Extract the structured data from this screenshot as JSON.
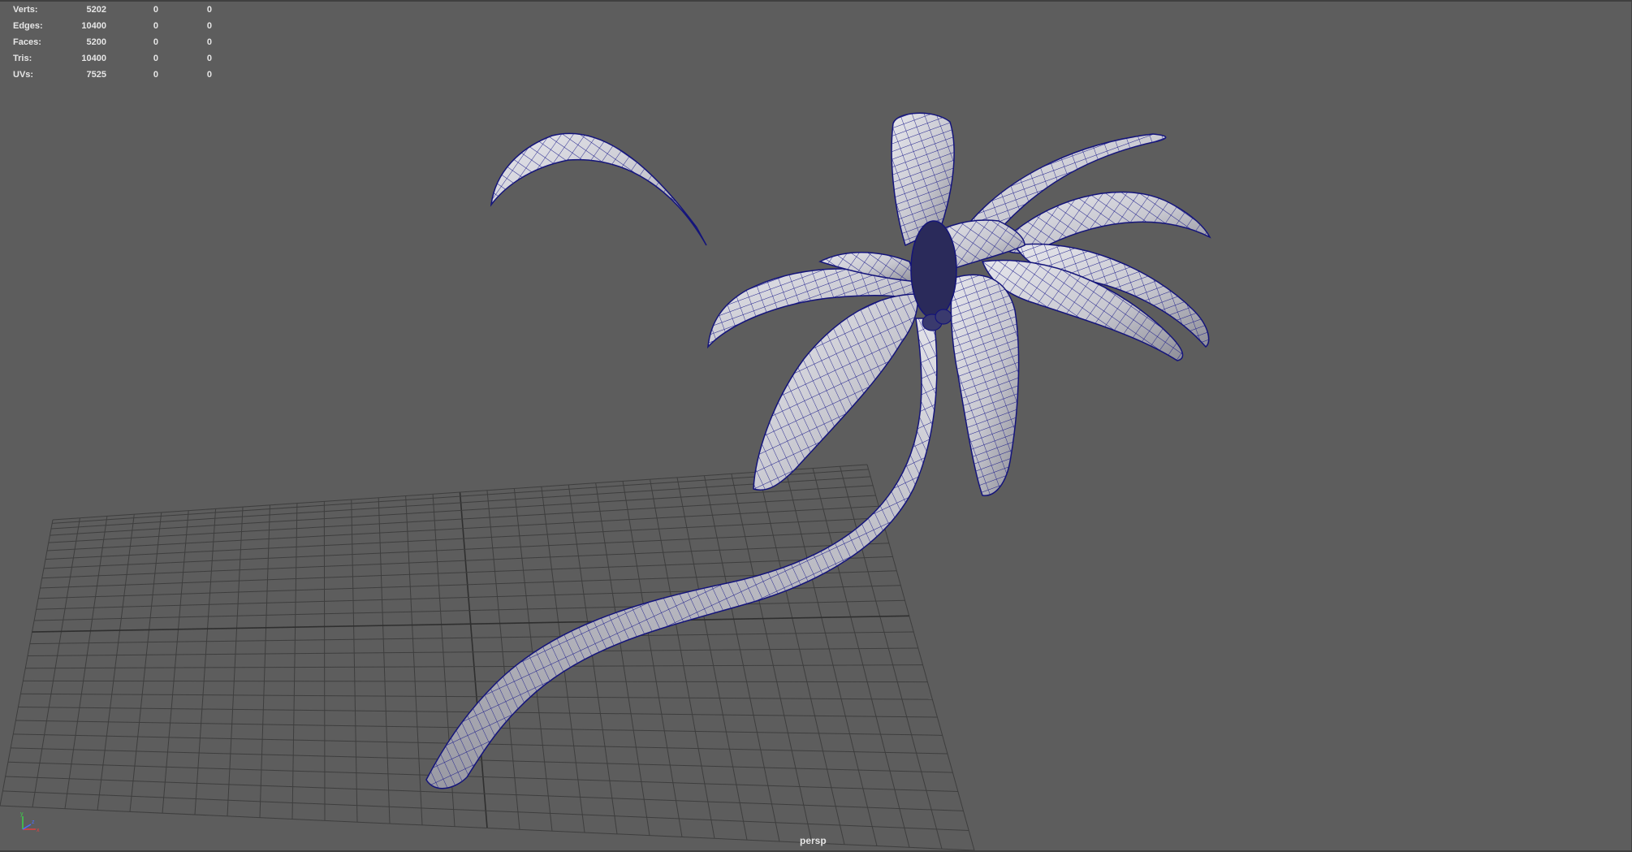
{
  "heads_up_display": {
    "rows": [
      {
        "label": "Verts:",
        "values": [
          "5202",
          "0",
          "0"
        ]
      },
      {
        "label": "Edges:",
        "values": [
          "10400",
          "0",
          "0"
        ]
      },
      {
        "label": "Faces:",
        "values": [
          "5200",
          "0",
          "0"
        ]
      },
      {
        "label": "Tris:",
        "values": [
          "10400",
          "0",
          "0"
        ]
      },
      {
        "label": "UVs:",
        "values": [
          "7525",
          "0",
          "0"
        ]
      }
    ]
  },
  "viewport": {
    "camera": "persp",
    "background_color": "#5d5d5d",
    "grid_color": "#3c3c3c",
    "wireframe_color": "#14147a",
    "mesh_color": "#cfcfd6"
  },
  "axis_indicator": {
    "x_label": "x",
    "y_label": "y",
    "z_label": "z",
    "icon": "xyz-axis-icon"
  }
}
